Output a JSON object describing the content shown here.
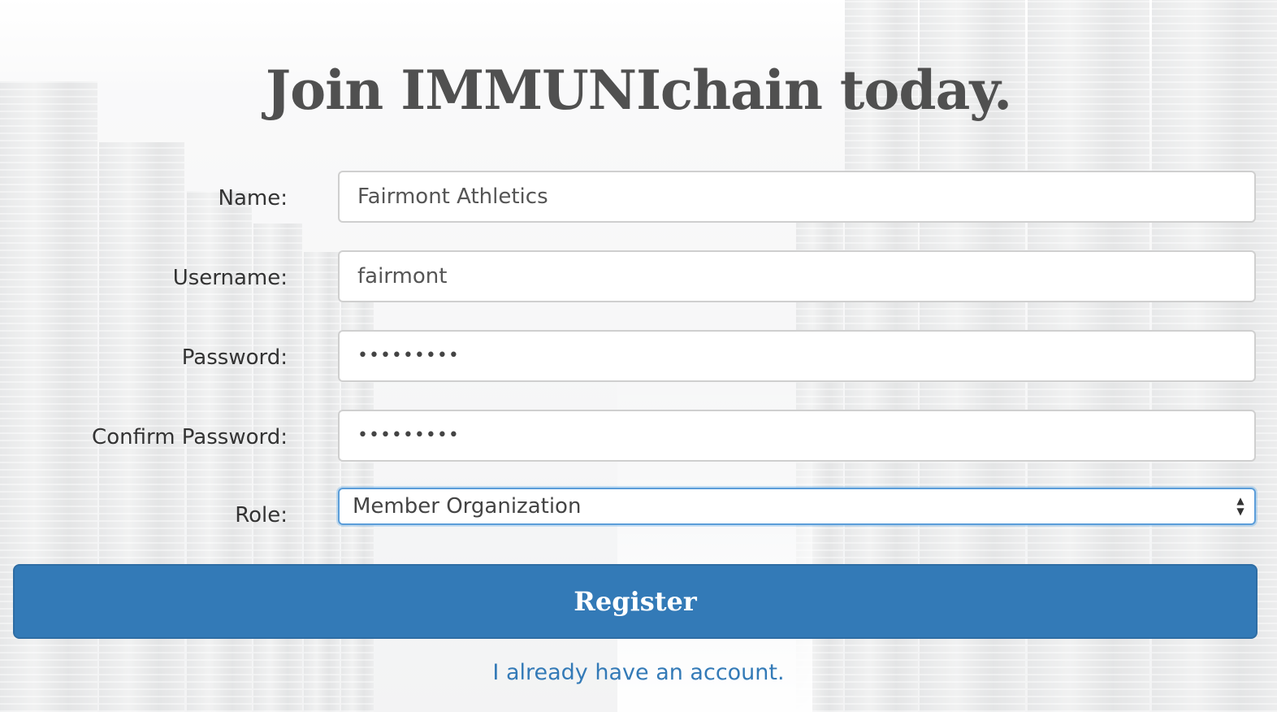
{
  "page": {
    "title": "Join IMMUNIchain today."
  },
  "form": {
    "name": {
      "label": "Name:",
      "value": "Fairmont Athletics"
    },
    "username": {
      "label": "Username:",
      "value": "fairmont"
    },
    "password": {
      "label": "Password:",
      "value": "•••••••••"
    },
    "confirm_password": {
      "label": "Confirm Password:",
      "value": "•••••••••"
    },
    "role": {
      "label": "Role:",
      "selected": "Member Organization"
    },
    "register_label": "Register",
    "login_link": "I already have an account."
  },
  "colors": {
    "primary": "#337ab7",
    "title": "#505050",
    "link": "#337ab7"
  }
}
